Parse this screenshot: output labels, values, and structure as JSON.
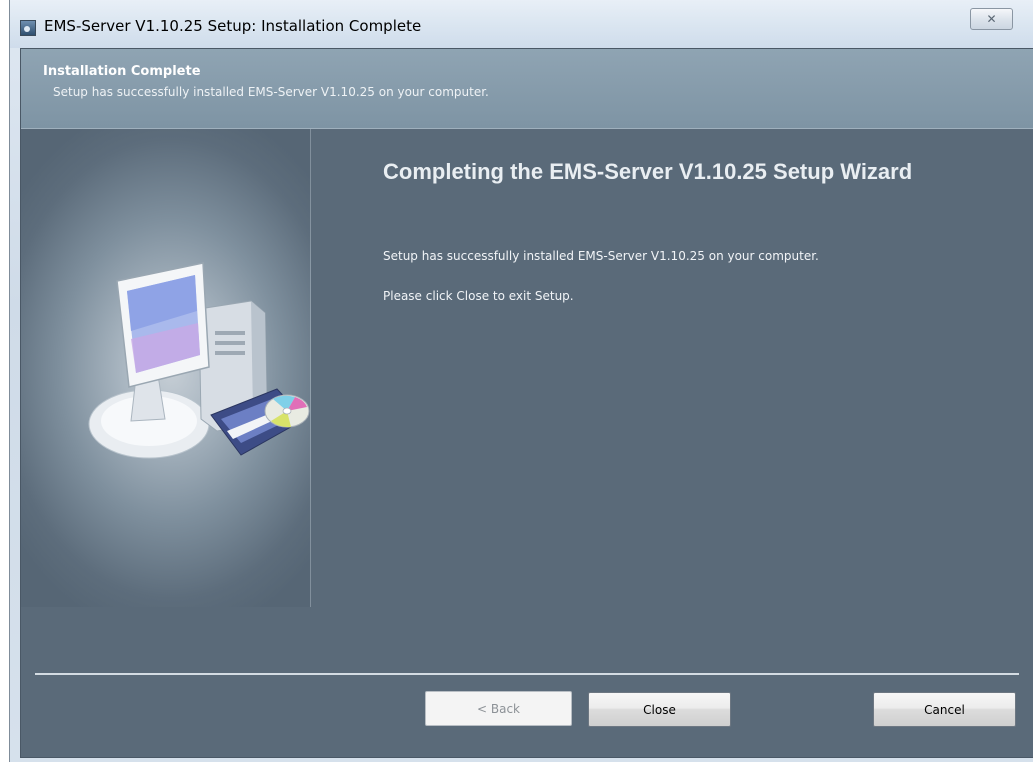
{
  "window": {
    "title": "EMS-Server V1.10.25 Setup: Installation Complete",
    "close_glyph": "✕"
  },
  "header": {
    "title": "Installation Complete",
    "subtitle": "Setup has successfully installed EMS-Server V1.10.25 on your computer."
  },
  "main": {
    "title": "Completing the EMS-Server V1.10.25 Setup Wizard",
    "text1": "Setup has successfully installed EMS-Server V1.10.25 on your computer.",
    "text2": "Please click Close to exit Setup."
  },
  "buttons": {
    "back": "< Back",
    "close": "Close",
    "cancel": "Cancel"
  },
  "icons": {
    "app": "setup-app-icon",
    "art": "computer-with-cd-icon"
  },
  "colors": {
    "panel": "#5a6a79",
    "header_band": "#8fa4b3",
    "title_text": "#e9eef2"
  }
}
